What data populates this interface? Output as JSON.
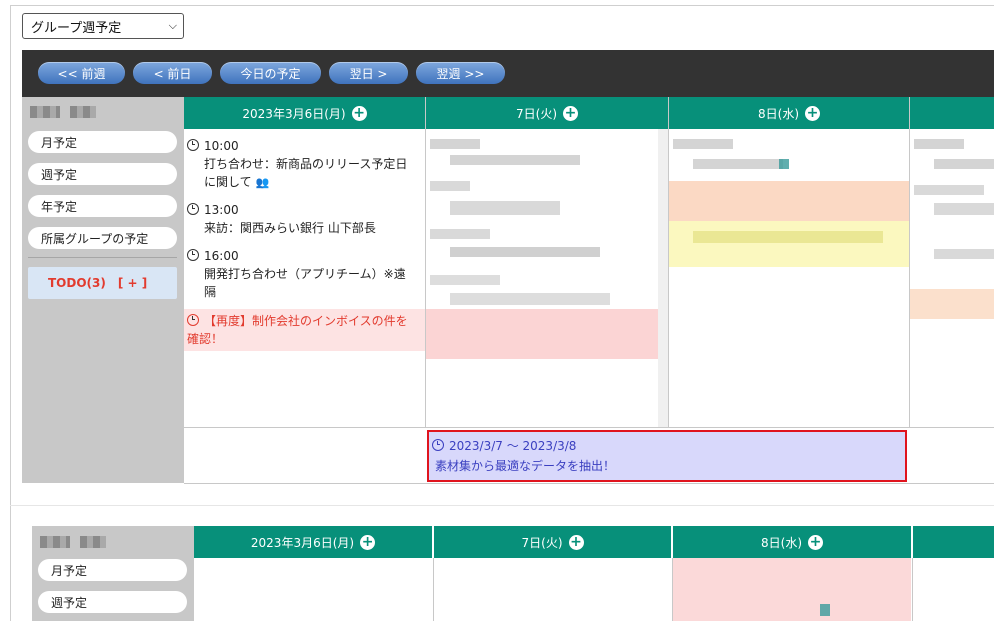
{
  "view_select": {
    "value": "グループ週予定",
    "icon": "chevron-down-icon"
  },
  "nav": {
    "prev_week": "<< 前週",
    "prev_day": "< 前日",
    "today": "今日の予定",
    "next_day": "翌日 >",
    "next_week": "翌週 >>"
  },
  "sidebar": {
    "items": [
      {
        "label": "月予定"
      },
      {
        "label": "週予定"
      },
      {
        "label": "年予定"
      },
      {
        "label": "所属グループの予定"
      }
    ],
    "todo_label": "TODO(3)",
    "todo_add": "[ + ]"
  },
  "days": [
    {
      "label": "2023年3月6日(月)"
    },
    {
      "label": "7日(火)"
    },
    {
      "label": "8日(水)"
    }
  ],
  "events_mon": [
    {
      "time": "10:00",
      "text": "打ち合わせ：新商品のリリース予定日に関して"
    },
    {
      "time": "13:00",
      "text": "来訪：関西みらい銀行 山下部長"
    },
    {
      "time": "16:00",
      "text": "開発打ち合わせ（アプリチーム）※遠隔"
    },
    {
      "text": "【再度】制作会社のインボイスの件を確認！"
    }
  ],
  "allday": {
    "range": "2023/3/7 〜 2023/3/8",
    "text": "素材集から最適なデータを抽出！"
  },
  "sidebar2": {
    "items": [
      {
        "label": "月予定"
      },
      {
        "label": "週予定"
      }
    ]
  },
  "colors": {
    "header_green": "#07907a",
    "toolbar_dark": "#333333",
    "button_blue": "#4a7dc4",
    "todo_red": "#e23b2e",
    "todo_bg": "#d9e6f5",
    "alert_bg": "#fde3e3",
    "allday_bg": "#d8d8fb",
    "allday_border": "#e0141e"
  }
}
